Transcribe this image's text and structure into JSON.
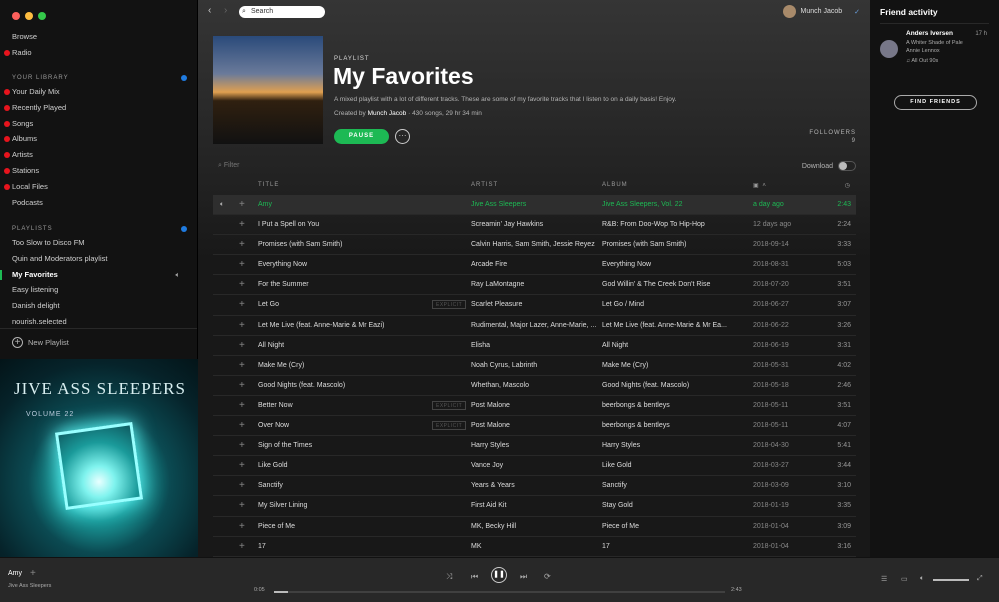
{
  "sidebar": {
    "browse": "Browse",
    "radio": "Radio",
    "library_header": "YOUR LIBRARY",
    "library": [
      "Your Daily Mix",
      "Recently Played",
      "Songs",
      "Albums",
      "Artists",
      "Stations",
      "Local Files",
      "Podcasts"
    ],
    "playlists_header": "PLAYLISTS",
    "playlists": [
      "Too Slow to Disco FM",
      "Quin and Moderators playlist",
      "My Favorites",
      "Easy listening",
      "Danish delight",
      "nourish.selected"
    ],
    "new_playlist": "New Playlist",
    "album_art": {
      "title": "JIVE ASS SLEEPERS",
      "subtitle": "VOLUME 22"
    }
  },
  "topbar": {
    "search_placeholder": "Search",
    "user": "Munch Jacob"
  },
  "playlist": {
    "type": "PLAYLIST",
    "title": "My Favorites",
    "description": "A mixed playlist with a lot of different tracks. These are some of my favorite tracks that I listen to on a daily basis! Enjoy.",
    "created_by_label": "Created by",
    "owner": "Munch Jacob",
    "stats": "· 430 songs, 29 hr 34 min",
    "pause": "PAUSE",
    "followers_label": "FOLLOWERS",
    "followers": "9",
    "filter_placeholder": "Filter",
    "download_label": "Download"
  },
  "table": {
    "headers": {
      "title": "TITLE",
      "artist": "ARTIST",
      "album": "ALBUM"
    },
    "explicit_label": "EXPLICIT",
    "rows": [
      {
        "title": "Amy",
        "artist": "Jive Ass Sleepers",
        "album": "Jive Ass Sleepers, Vol. 22",
        "date": "a day ago",
        "duration": "2:43",
        "explicit": false
      },
      {
        "title": "I Put a Spell on You",
        "artist": "Screamin' Jay Hawkins",
        "album": "R&B: From Doo-Wop To Hip-Hop",
        "date": "12 days ago",
        "duration": "2:24",
        "explicit": false
      },
      {
        "title": "Promises (with Sam Smith)",
        "artist": "Calvin Harris, Sam Smith, Jessie Reyez",
        "album": "Promises (with Sam Smith)",
        "date": "2018-09-14",
        "duration": "3:33",
        "explicit": false
      },
      {
        "title": "Everything Now",
        "artist": "Arcade Fire",
        "album": "Everything Now",
        "date": "2018-08-31",
        "duration": "5:03",
        "explicit": false
      },
      {
        "title": "For the Summer",
        "artist": "Ray LaMontagne",
        "album": "God Willin' & The Creek Don't Rise",
        "date": "2018-07-20",
        "duration": "3:51",
        "explicit": false
      },
      {
        "title": "Let Go",
        "artist": "Scarlet Pleasure",
        "album": "Let Go / Mind",
        "date": "2018-06-27",
        "duration": "3:07",
        "explicit": true
      },
      {
        "title": "Let Me Live (feat. Anne-Marie & Mr Eazi)",
        "artist": "Rudimental, Major Lazer, Anne-Marie, ...",
        "album": "Let Me Live (feat. Anne-Marie & Mr Ea...",
        "date": "2018-06-22",
        "duration": "3:26",
        "explicit": false
      },
      {
        "title": "All Night",
        "artist": "Elisha",
        "album": "All Night",
        "date": "2018-06-19",
        "duration": "3:31",
        "explicit": false
      },
      {
        "title": "Make Me (Cry)",
        "artist": "Noah Cyrus, Labrinth",
        "album": "Make Me (Cry)",
        "date": "2018-05-31",
        "duration": "4:02",
        "explicit": false
      },
      {
        "title": "Good Nights (feat. Mascolo)",
        "artist": "Whethan, Mascolo",
        "album": "Good Nights (feat. Mascolo)",
        "date": "2018-05-18",
        "duration": "2:46",
        "explicit": false
      },
      {
        "title": "Better Now",
        "artist": "Post Malone",
        "album": "beerbongs & bentleys",
        "date": "2018-05-11",
        "duration": "3:51",
        "explicit": true
      },
      {
        "title": "Over Now",
        "artist": "Post Malone",
        "album": "beerbongs & bentleys",
        "date": "2018-05-11",
        "duration": "4:07",
        "explicit": true
      },
      {
        "title": "Sign of the Times",
        "artist": "Harry Styles",
        "album": "Harry Styles",
        "date": "2018-04-30",
        "duration": "5:41",
        "explicit": false
      },
      {
        "title": "Like Gold",
        "artist": "Vance Joy",
        "album": "Like Gold",
        "date": "2018-03-27",
        "duration": "3:44",
        "explicit": false
      },
      {
        "title": "Sanctify",
        "artist": "Years & Years",
        "album": "Sanctify",
        "date": "2018-03-09",
        "duration": "3:10",
        "explicit": false
      },
      {
        "title": "My Silver Lining",
        "artist": "First Aid Kit",
        "album": "Stay Gold",
        "date": "2018-01-19",
        "duration": "3:35",
        "explicit": false
      },
      {
        "title": "Piece of Me",
        "artist": "MK, Becky Hill",
        "album": "Piece of Me",
        "date": "2018-01-04",
        "duration": "3:09",
        "explicit": false
      },
      {
        "title": "17",
        "artist": "MK",
        "album": "17",
        "date": "2018-01-04",
        "duration": "3:16",
        "explicit": false
      }
    ]
  },
  "friends": {
    "title": "Friend activity",
    "name": "Anders Iversen",
    "time": "17 h",
    "track": "A Whiter Shade of Pale",
    "artist": "Annie Lennox",
    "context": "All Out 90s",
    "find_button": "FIND FRIENDS"
  },
  "player": {
    "track": "Amy",
    "artist": "Jive Ass Sleepers",
    "elapsed": "0:05",
    "total": "2:43",
    "progress_percent": 3,
    "volume_percent": 100
  },
  "colors": {
    "accent": "#1db954",
    "notification": "#e8141d",
    "badge": "#1f7be0"
  }
}
